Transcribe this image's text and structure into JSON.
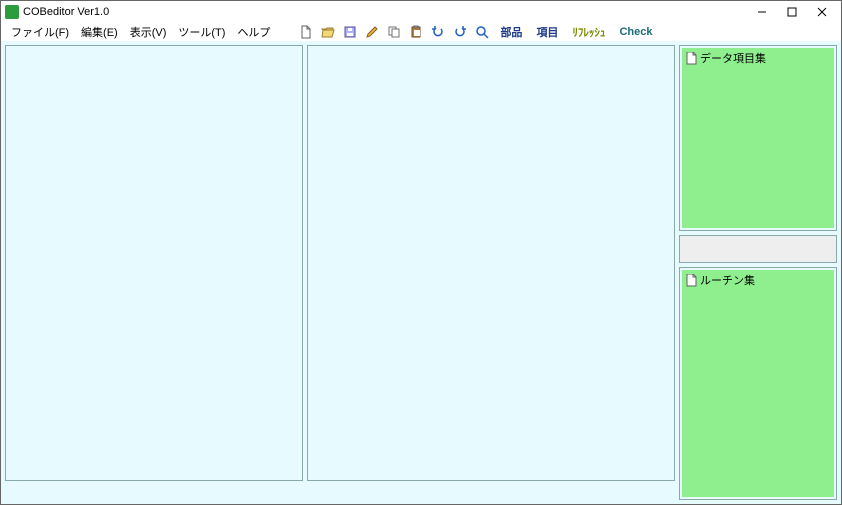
{
  "titlebar": {
    "title": "COBeditor Ver1.0"
  },
  "menu": {
    "file": "ファイル(F)",
    "edit": "編集(E)",
    "view": "表示(V)",
    "tool": "ツール(T)",
    "help": "ヘルプ"
  },
  "toolbar": {
    "new_icon": "new-file-icon",
    "open_icon": "folder-open-icon",
    "save_icon": "save-icon",
    "edit_icon": "pencil-icon",
    "copy_icon": "copy-icon",
    "paste_icon": "clipboard-icon",
    "undo_icon": "undo-icon",
    "redo_icon": "redo-icon",
    "search_icon": "search-icon",
    "parts": "部品",
    "item": "項目",
    "refresh": "ﾘﾌﾚｯｼｭ",
    "check": "Check"
  },
  "panels": {
    "data_items": "データ項目集",
    "routines": "ルーチン集"
  }
}
